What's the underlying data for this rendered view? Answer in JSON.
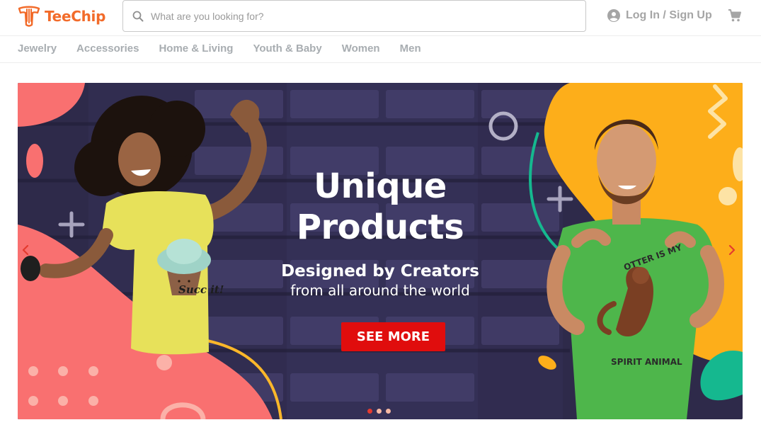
{
  "brand": {
    "name": "TeeChip",
    "color": "#f26b2a"
  },
  "search": {
    "placeholder": "What are you looking for?",
    "value": ""
  },
  "account": {
    "label": "Log In / Sign Up"
  },
  "categories": [
    "Jewelry",
    "Accessories",
    "Home & Living",
    "Youth & Baby",
    "Women",
    "Men"
  ],
  "banner": {
    "title_line1": "Unique",
    "title_line2": "Products",
    "subtitle_line1": "Designed by Creators",
    "subtitle_line2": "from all around the world",
    "cta_label": "SEE MORE",
    "cta_color": "#e00d0d",
    "slides_total": 3,
    "active_slide": 1,
    "shirt_left_text": "Succ it!",
    "shirt_right_text_top": "OTTER IS MY",
    "shirt_right_text_bottom": "SPIRIT ANIMAL"
  },
  "icons": {
    "search": "search-icon",
    "account": "user-circle-icon",
    "cart": "cart-icon",
    "prev": "chevron-left-icon",
    "next": "chevron-right-icon"
  }
}
